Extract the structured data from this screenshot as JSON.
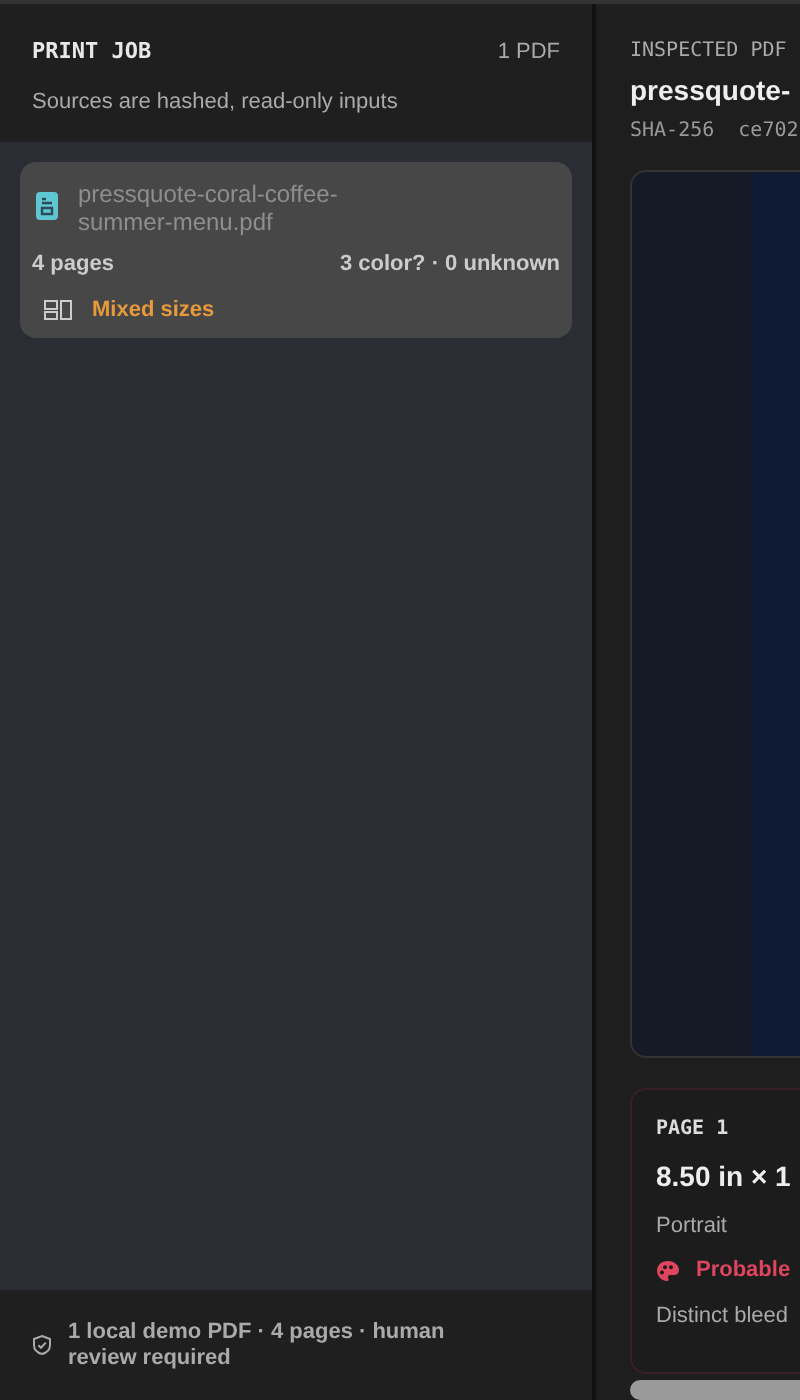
{
  "print_job": {
    "title": "PRINT JOB",
    "count": "1 PDF",
    "subtitle": "Sources are hashed, read-only inputs"
  },
  "files": [
    {
      "name": "pressquote-coral-coffee-summer-menu.pdf",
      "pages": "4 pages",
      "summary": "3 color? · 0 unknown",
      "note": "Mixed sizes",
      "selected": true
    }
  ],
  "footer": {
    "text": "1 local demo PDF · 4 pages · human review required"
  },
  "inspected": {
    "label": "INSPECTED PDF",
    "name": "pressquote-",
    "hash_label": "SHA-256",
    "hash": "ce702"
  },
  "page_card": {
    "title": "PAGE 1",
    "size": "8.50 in × 1",
    "orientation": "Portrait",
    "color_note": "Probable",
    "bleed": "Distinct bleed"
  }
}
